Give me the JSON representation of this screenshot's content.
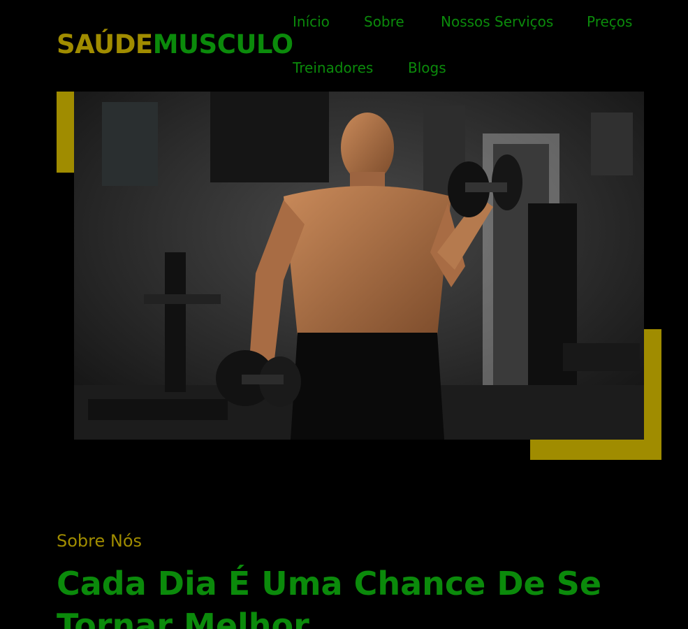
{
  "brand": {
    "part1": "SAÚDE",
    "part2": "MUSCULO"
  },
  "nav": {
    "items": [
      {
        "label": "Início"
      },
      {
        "label": "Sobre"
      },
      {
        "label": "Nossos Serviços"
      },
      {
        "label": "Preços"
      },
      {
        "label": "Treinadores"
      },
      {
        "label": "Blogs"
      }
    ]
  },
  "about": {
    "label": "Sobre Nós",
    "headline": "Cada Dia É Uma Chance De Se Tornar Melhor"
  },
  "colors": {
    "accent_gold": "#a08c00",
    "accent_green": "#0b8a0b",
    "background": "#000000"
  }
}
